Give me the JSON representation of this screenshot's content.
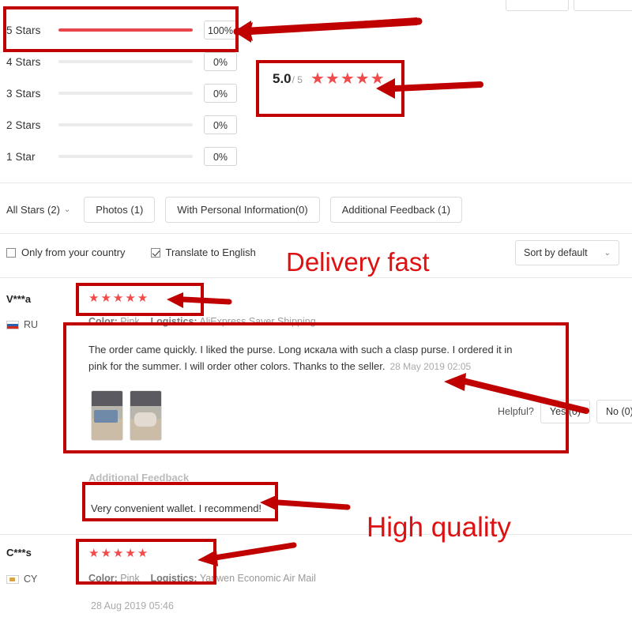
{
  "rating_breakdown": {
    "rows": [
      {
        "label": "5 Stars",
        "percent_label": "100%",
        "percent": 100
      },
      {
        "label": "4 Stars",
        "percent_label": "0%",
        "percent": 0
      },
      {
        "label": "3 Stars",
        "percent_label": "0%",
        "percent": 0
      },
      {
        "label": "2 Stars",
        "percent_label": "0%",
        "percent": 0
      },
      {
        "label": "1 Star",
        "percent_label": "0%",
        "percent": 0
      }
    ],
    "fill_color": "#e8464a",
    "track_color": "#ebebeb"
  },
  "score_card": {
    "score": "5.0",
    "denominator": "/ 5",
    "stars": "★★★★★",
    "star_color": "#f04a4a"
  },
  "filters": {
    "all_stars_label": "All Stars (2)",
    "chevron": "⌄",
    "tabs": [
      {
        "label": "Photos (1)"
      },
      {
        "label": "With Personal Information(0)"
      },
      {
        "label": "Additional Feedback (1)"
      }
    ]
  },
  "options": {
    "only_country": {
      "label": "Only from your country",
      "checked": false
    },
    "translate": {
      "label": "Translate to English",
      "checked": true
    }
  },
  "sort": {
    "value": "Sort by default",
    "chevron": "⌄"
  },
  "reviews": [
    {
      "name": "V***a",
      "country_code": "RU",
      "stars": "★★★★★",
      "color_label": "Color:",
      "color_value": "Pink",
      "logistics_label": "Logistics:",
      "logistics_value": "AliExpress Saver Shipping",
      "text": "The order came quickly. I liked the purse. Long искала with such a clasp purse. I ordered it in pink for the summer. I will order other colors. Thanks to the seller.",
      "timestamp": "28 May 2019 02:05",
      "photos_count": 2,
      "helpful_label": "Helpful?",
      "helpful_yes": "Yes (0)",
      "helpful_no": "No (0)",
      "additional_feedback_title": "Additional Feedback",
      "additional_feedback_text": "Very convenient wallet. I recommend!"
    },
    {
      "name": "C***s",
      "country_code": "CY",
      "stars": "★★★★★",
      "color_label": "Color:",
      "color_value": "Pink",
      "logistics_label": "Logistics:",
      "logistics_value": "Yanwen Economic Air Mail",
      "timestamp": "28 Aug 2019 05:46"
    }
  ],
  "annotations": {
    "color": "#c00000",
    "text_color": "#dd1111",
    "labels": [
      {
        "text": "Delivery fast"
      },
      {
        "text": "High quality"
      }
    ]
  }
}
